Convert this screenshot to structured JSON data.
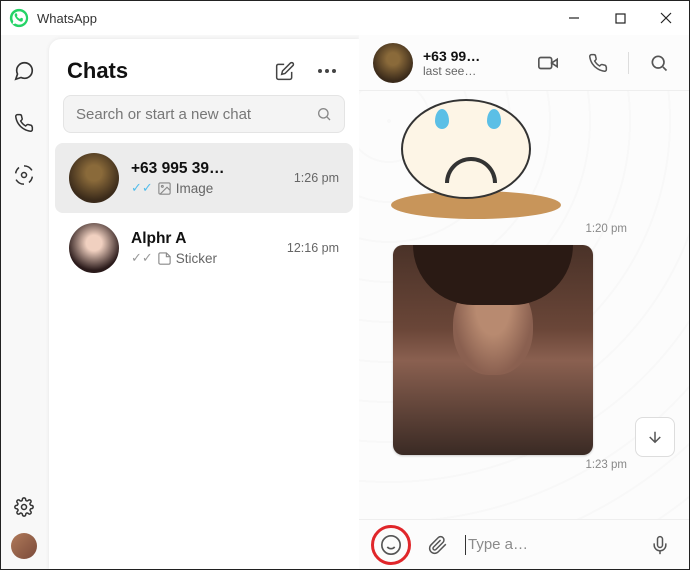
{
  "titlebar": {
    "app_name": "WhatsApp"
  },
  "sidebar": {
    "title": "Chats",
    "search_placeholder": "Search or start a new chat",
    "chats": [
      {
        "name": "+63 995 39…",
        "preview": "Image",
        "time": "1:26 pm",
        "read": true,
        "type": "image",
        "active": true
      },
      {
        "name": "Alphr A",
        "preview": "Sticker",
        "time": "12:16 pm",
        "read": false,
        "type": "sticker",
        "active": false
      }
    ]
  },
  "conversation": {
    "header": {
      "name": "+63 99…",
      "status": "last see…"
    },
    "messages": [
      {
        "kind": "sticker",
        "time": "1:20 pm"
      },
      {
        "kind": "image",
        "time": "1:23 pm"
      }
    ],
    "compose": {
      "placeholder": "Type a…"
    }
  }
}
